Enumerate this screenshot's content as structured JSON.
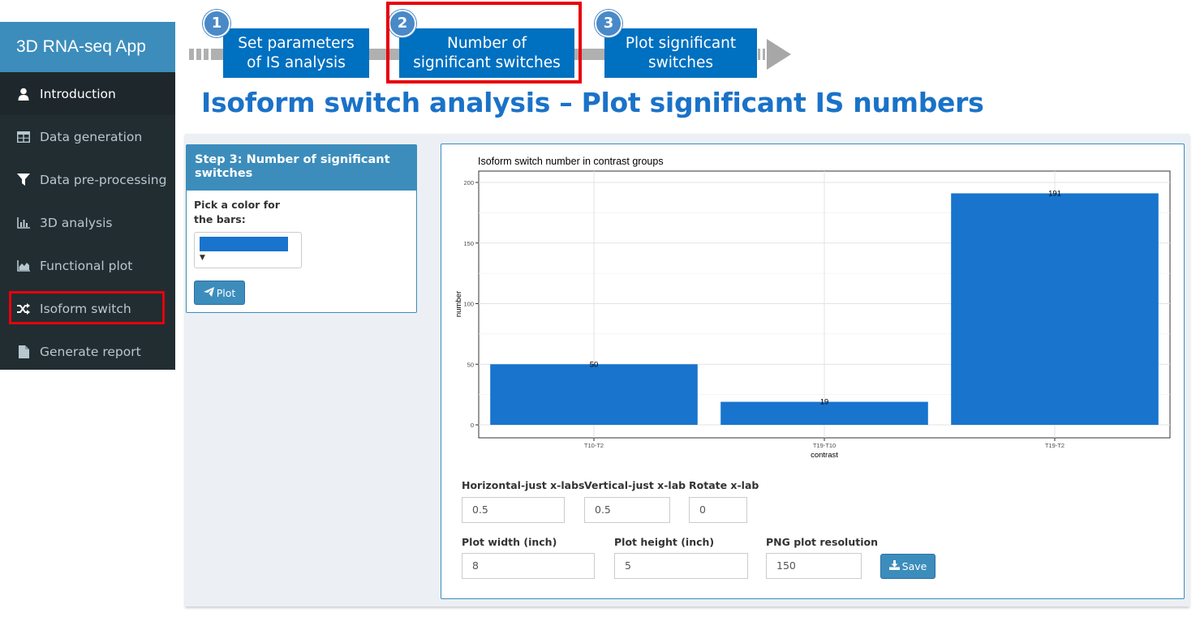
{
  "app": {
    "title": "3D RNA-seq App"
  },
  "sidebar": {
    "items": [
      {
        "label": "Introduction",
        "icon": "user-icon"
      },
      {
        "label": "Data generation",
        "icon": "table-icon"
      },
      {
        "label": "Data pre-processing",
        "icon": "filter-icon"
      },
      {
        "label": "3D analysis",
        "icon": "bar-chart-icon"
      },
      {
        "label": "Functional plot",
        "icon": "area-chart-icon"
      },
      {
        "label": "Isoform switch",
        "icon": "random-icon"
      },
      {
        "label": "Generate report",
        "icon": "file-icon"
      }
    ],
    "active_index": 0,
    "highlighted_index": 5
  },
  "workflow": {
    "steps": [
      {
        "number": "1",
        "line1": "Set parameters",
        "line2": "of IS analysis"
      },
      {
        "number": "2",
        "line1": "Number of",
        "line2": "significant switches"
      },
      {
        "number": "3",
        "line1": "Plot significant",
        "line2": "switches"
      }
    ],
    "highlighted_step": 2
  },
  "page": {
    "title": "Isoform switch analysis – Plot significant IS numbers"
  },
  "left_panel": {
    "header": "Step 3: Number of significant switches",
    "color_label": "Pick a color for the bars:",
    "color_value": "#1874CD",
    "caret": "▼",
    "plot_button": "Plot"
  },
  "chart_data": {
    "type": "bar",
    "title": "Isoform switch number in contrast groups",
    "xlabel": "contrast",
    "ylabel": "number",
    "categories": [
      "T10-T2",
      "T19-T10",
      "T19-T2"
    ],
    "values": [
      50,
      19,
      191
    ],
    "data_labels": [
      "50",
      "19",
      "191"
    ],
    "ylim": [
      0,
      200
    ],
    "yticks": [
      0,
      50,
      100,
      150,
      200
    ],
    "bar_color": "#1874CD",
    "grid": true
  },
  "controls": {
    "hjust_label": "Horizontal-just x-labs",
    "hjust_value": "0.5",
    "vjust_label": "Vertical-just x-lab",
    "vjust_value": "0.5",
    "rotate_label": "Rotate x-lab",
    "rotate_value": "0",
    "width_label": "Plot width (inch)",
    "width_value": "8",
    "height_label": "Plot height (inch)",
    "height_value": "5",
    "res_label": "PNG plot resolution",
    "res_value": "150",
    "save_button": "Save"
  }
}
